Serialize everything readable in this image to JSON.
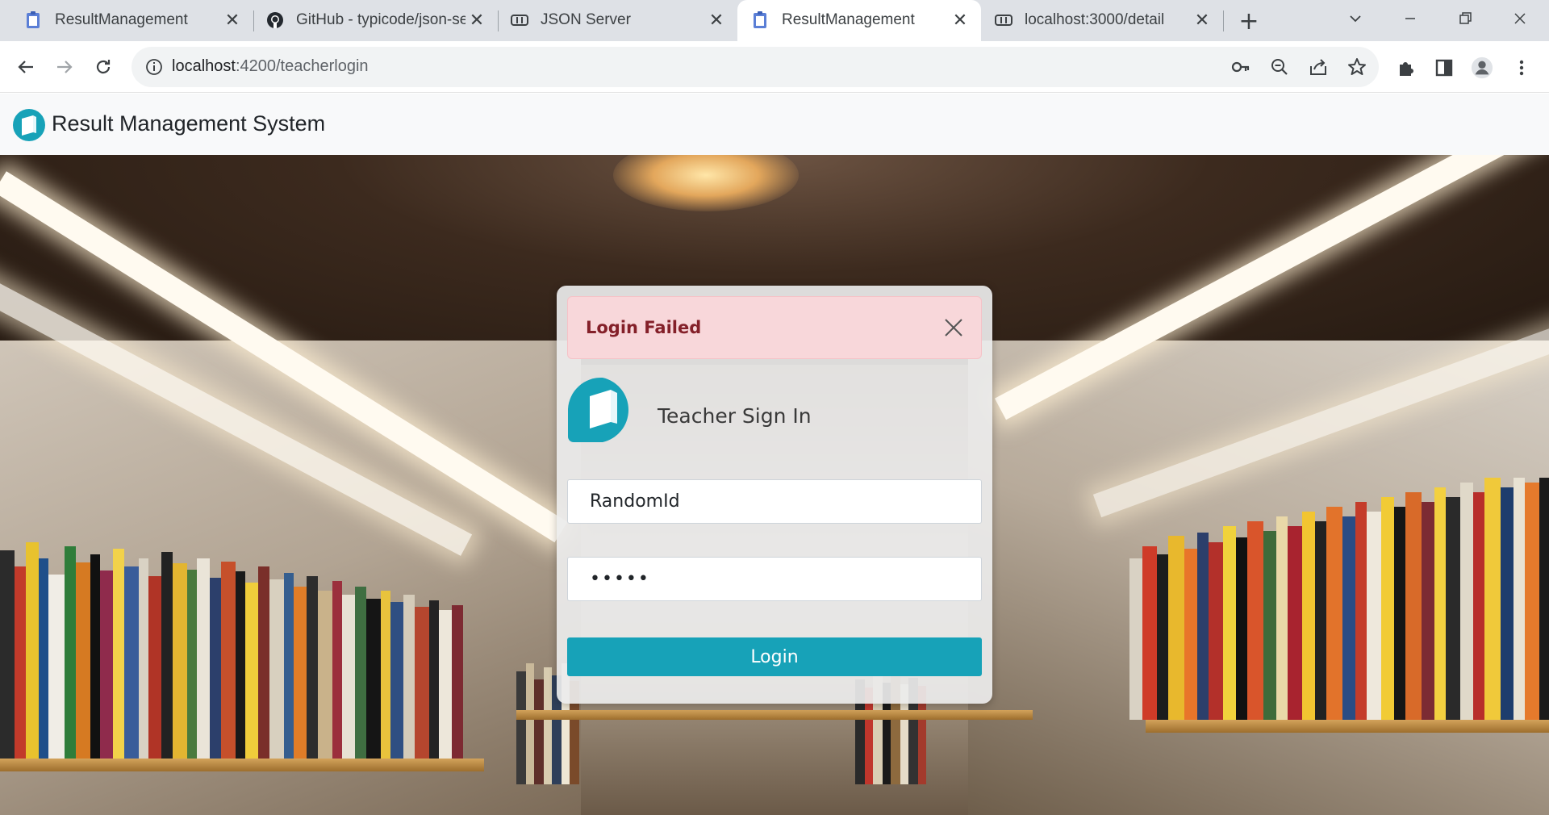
{
  "browser": {
    "tabs": [
      {
        "title": "ResultManagement",
        "icon": "clipboard-icon",
        "active": false
      },
      {
        "title": "GitHub - typicode/json-se",
        "icon": "github-icon",
        "active": false
      },
      {
        "title": "JSON Server",
        "icon": "json-server-icon",
        "active": false
      },
      {
        "title": "ResultManagement",
        "icon": "clipboard-icon",
        "active": true
      },
      {
        "title": "localhost:3000/detail",
        "icon": "json-server-icon",
        "active": false
      }
    ],
    "close_glyph": "✕",
    "newtab_glyph": "+",
    "url_host": "localhost",
    "url_path": ":4200/teacherlogin"
  },
  "app": {
    "brand": "Result Management System",
    "accent": "#17a2b8"
  },
  "alert": {
    "message": "Login Failed",
    "color": "#842029",
    "background": "#f8d7da"
  },
  "signin": {
    "title": "Teacher Sign In",
    "id_value": "RandomId",
    "password_mask": "•••••",
    "login_label": "Login"
  }
}
